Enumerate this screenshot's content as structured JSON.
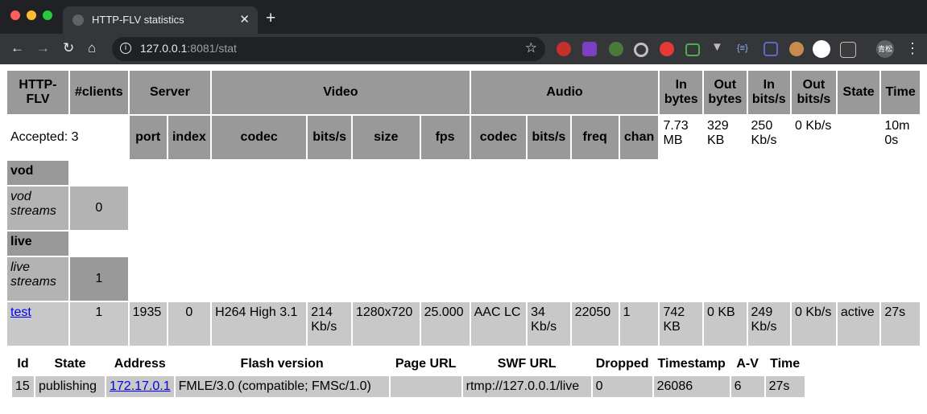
{
  "browser": {
    "tab_title": "HTTP-FLV statistics",
    "url_host": "127.0.0.1",
    "url_rest": ":8081/stat",
    "traffic_lights": [
      "#ff5f57",
      "#febc2e",
      "#28c840"
    ],
    "extensions": [
      "abp-icon",
      "rp-icon",
      "ext-green-icon",
      "ext-circle-icon",
      "ext-red-icon",
      "ext-tv-icon",
      "ext-v-icon",
      "ext-braces-icon",
      "ext-share-icon",
      "ext-cookie-icon",
      "ext-shield-icon",
      "ext-a-icon"
    ],
    "profile_label": "青松"
  },
  "stats": {
    "headers": {
      "http_flv": "HTTP-FLV",
      "clients": "#clients",
      "server": "Server",
      "video": "Video",
      "audio": "Audio",
      "in_bytes": "In bytes",
      "out_bytes": "Out bytes",
      "in_bits": "In bits/s",
      "out_bits": "Out bits/s",
      "state": "State",
      "time": "Time"
    },
    "subheaders": {
      "port": "port",
      "index": "index",
      "vcodec": "codec",
      "vbits": "bits/s",
      "size": "size",
      "fps": "fps",
      "acodec": "codec",
      "abits": "bits/s",
      "freq": "freq",
      "chan": "chan"
    },
    "accepted": "Accepted: 3",
    "totals": {
      "in_bytes": "7.73 MB",
      "out_bytes": "329 KB",
      "in_bits": "250 Kb/s",
      "out_bits": "0 Kb/s",
      "time": "10m 0s"
    },
    "vod": {
      "label": "vod",
      "streams_label": "vod streams",
      "streams": "0"
    },
    "live": {
      "label": "live",
      "streams_label": "live streams",
      "streams": "1"
    },
    "stream": {
      "name": "test",
      "clients": "1",
      "port": "1935",
      "index": "0",
      "vcodec": "H264 High 3.1",
      "vbits": "214 Kb/s",
      "size": "1280x720",
      "fps": "25.000",
      "acodec": "AAC LC",
      "abits": "34 Kb/s",
      "freq": "22050",
      "chan": "1",
      "in_bytes": "742 KB",
      "out_bytes": "0 KB",
      "in_bits": "249 Kb/s",
      "out_bits": "0 Kb/s",
      "state": "active",
      "time": "27s"
    }
  },
  "clients": {
    "headers": {
      "id": "Id",
      "state": "State",
      "address": "Address",
      "flash": "Flash version",
      "page_url": "Page URL",
      "swf_url": "SWF URL",
      "dropped": "Dropped",
      "timestamp": "Timestamp",
      "av": "A-V",
      "time": "Time"
    },
    "row": {
      "id": "15",
      "state": "publishing",
      "address": "172.17.0.1",
      "flash": "FMLE/3.0 (compatible; FMSc/1.0)",
      "page_url": "",
      "swf_url": "rtmp://127.0.0.1/live",
      "dropped": "0",
      "timestamp": "26086",
      "av": "6",
      "time": "27s"
    }
  }
}
